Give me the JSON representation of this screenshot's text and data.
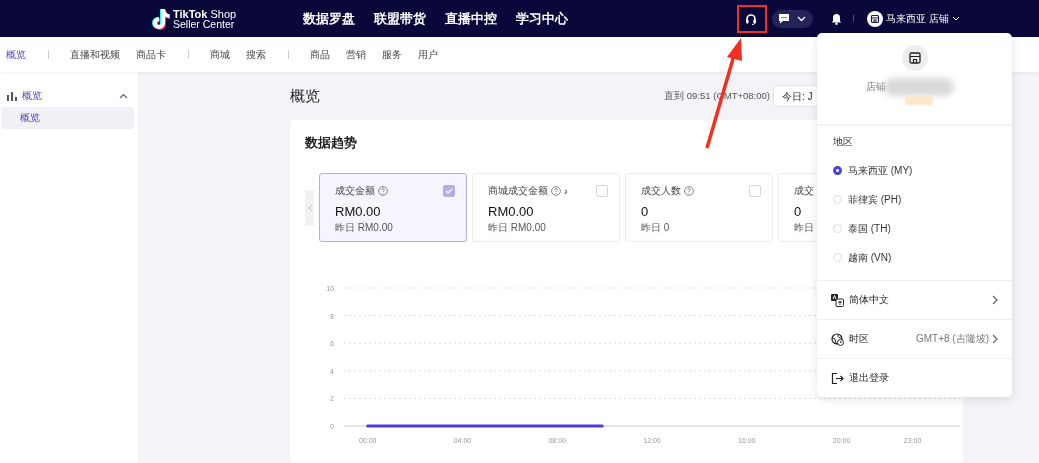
{
  "top_bar": {
    "logo": {
      "line_1": "TikTok Shop",
      "line_2": "Seller Center"
    },
    "nav": [
      {
        "label": "数据罗盘"
      },
      {
        "label": "联盟带货"
      },
      {
        "label": "直播中控"
      },
      {
        "label": "学习中心"
      }
    ],
    "account": {
      "name": "马来西亚 店铺"
    }
  },
  "sub_nav": {
    "groups": [
      [
        {
          "label": "概览",
          "selected": true
        }
      ],
      [
        {
          "label": "直播和视频",
          "selected": false
        },
        {
          "label": "商品卡",
          "selected": false
        }
      ],
      [
        {
          "label": "商城",
          "selected": false
        },
        {
          "label": "搜索",
          "selected": false
        }
      ],
      [
        {
          "label": "商品",
          "selected": false
        },
        {
          "label": "营销",
          "selected": false
        },
        {
          "label": "服务",
          "selected": false
        },
        {
          "label": "用户",
          "selected": false
        }
      ]
    ]
  },
  "sidebar": {
    "items": [
      {
        "label": "概览",
        "expanded": true,
        "children": [
          {
            "label": "概览",
            "selected": true
          }
        ]
      }
    ]
  },
  "page": {
    "title": "概览",
    "updated": "直到 09:51 (GMT+08:00)",
    "date_picker": "今日: J"
  },
  "panel": {
    "title": "数据趋势",
    "metrics": [
      {
        "label": "成交金额",
        "help": true,
        "checked": true,
        "value": "RM0.00",
        "previous": "昨日 RM0.00"
      },
      {
        "label": "商城成交金额",
        "help": true,
        "link_mark": "›",
        "checked": false,
        "value": "RM0.00",
        "previous": "昨日 RM0.00"
      },
      {
        "label": "成交人数",
        "help": true,
        "checked": false,
        "value": "0",
        "previous": "昨日 0"
      },
      {
        "label": "成交",
        "value": "0",
        "previous": "昨日"
      }
    ],
    "chart_data": {
      "type": "line",
      "x": [
        0,
        9.9
      ],
      "series": [
        {
          "color": "#4d3ed8",
          "values": [
            0,
            0
          ]
        }
      ],
      "xlim": [
        -1,
        25
      ],
      "ylim": [
        0,
        10
      ],
      "yticks": [
        0,
        2,
        4,
        6,
        8,
        10
      ],
      "grid": true,
      "xticks": [
        {
          "value": 0,
          "label": "00:00"
        },
        {
          "value": 4,
          "label": "04:00"
        },
        {
          "value": 8,
          "label": "08:00"
        },
        {
          "value": 12,
          "label": "12:00"
        },
        {
          "value": 16,
          "label": "16:00"
        },
        {
          "value": 20,
          "label": "20:00"
        },
        {
          "value": 23,
          "label": "23:00"
        }
      ]
    }
  },
  "account_menu": {
    "store_label": "店铺",
    "region_title": "地区",
    "regions": [
      {
        "label": "马来西亚 (MY)",
        "selected": true
      },
      {
        "label": "菲律宾 (PH)",
        "selected": false
      },
      {
        "label": "泰国 (TH)",
        "selected": false
      },
      {
        "label": "越南 (VN)",
        "selected": false
      }
    ],
    "rows": [
      {
        "kind": "language",
        "label": "简体中文"
      },
      {
        "kind": "timezone",
        "label": "时区",
        "value": "GMT+8 (吉隆坡)"
      },
      {
        "kind": "logout",
        "label": "退出登录"
      }
    ]
  }
}
